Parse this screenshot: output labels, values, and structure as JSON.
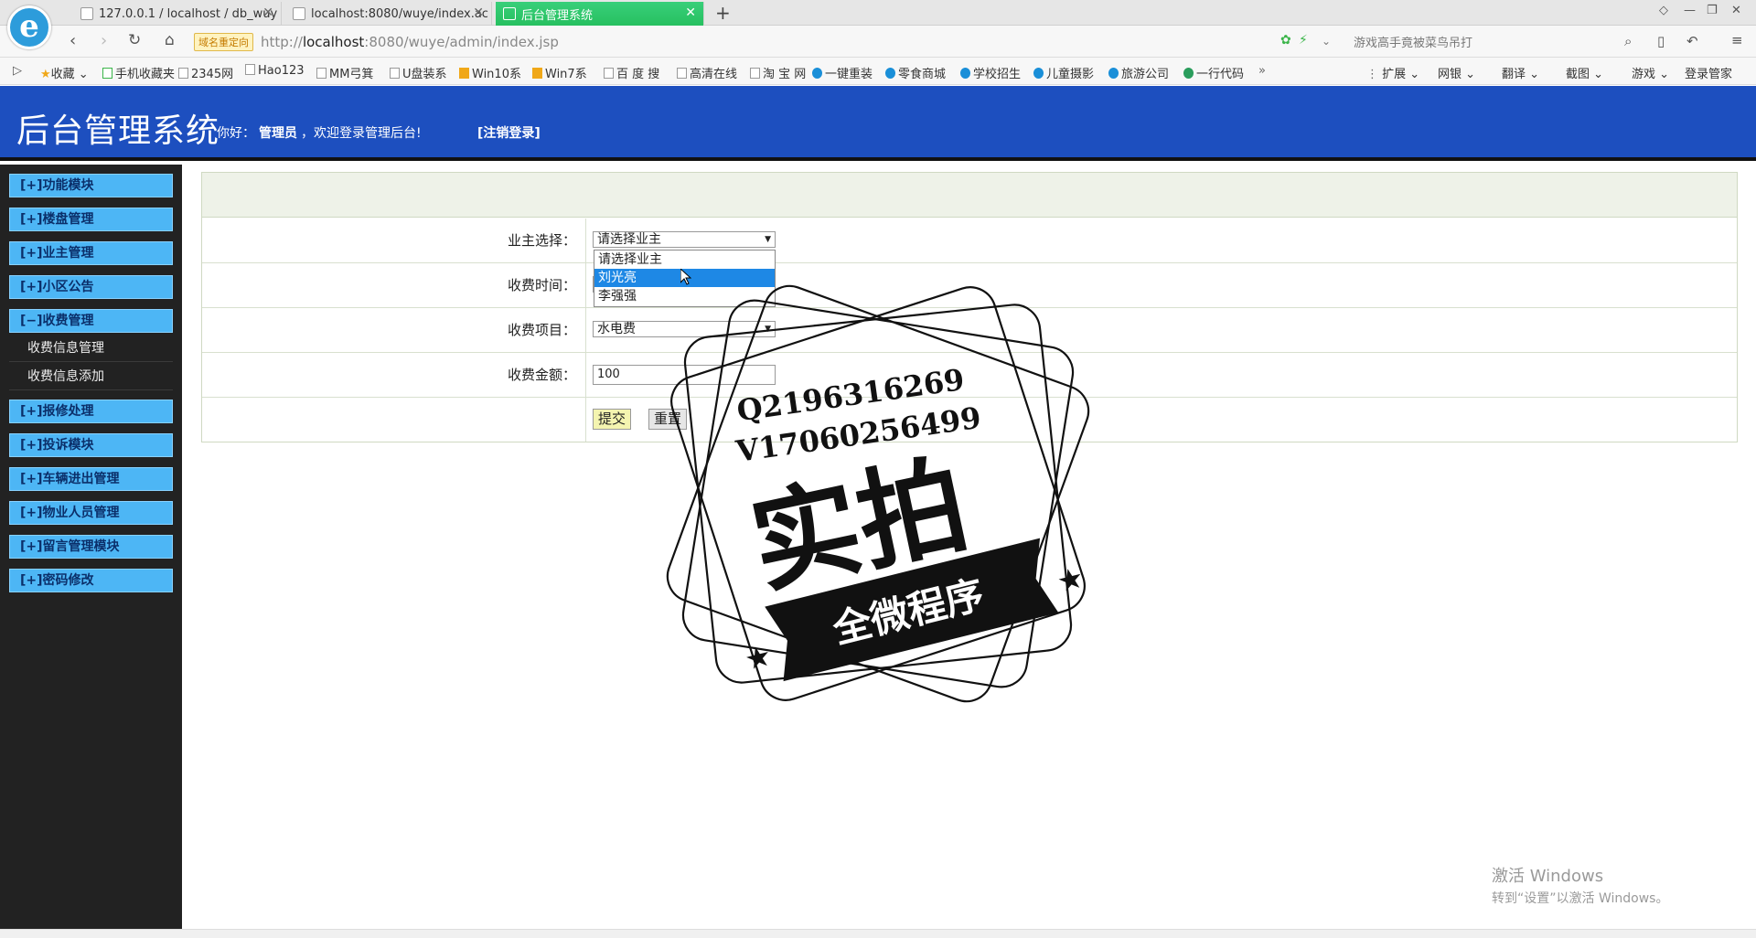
{
  "browser": {
    "tabs": [
      {
        "label": "127.0.0.1 / localhost / db_wuy",
        "icon": "pma-icon"
      },
      {
        "label": "localhost:8080/wuye/index.ac",
        "icon": "page-icon"
      },
      {
        "label": "后台管理系统",
        "icon": "page-icon"
      }
    ],
    "new_tab": "+",
    "redirect_badge": "域名重定向",
    "url_prefix": "http://",
    "url_host": "localhost",
    "url_rest": ":8080/wuye/admin/index.jsp",
    "search_placeholder": "游戏高手竟被菜鸟吊打",
    "bookmarks": [
      "收藏",
      "手机收藏夹",
      "2345网",
      "Hao123",
      "MM弓箕",
      "U盘装系",
      "Win10系",
      "Win7系",
      "百 度 搜",
      "高清在线",
      "淘 宝 网",
      "一键重装",
      "零食商城",
      "学校招生",
      "儿童摄影",
      "旅游公司",
      "一行代码",
      "»"
    ],
    "tools": [
      "扩展",
      "网银",
      "翻译",
      "截图",
      "游戏",
      "登录管家"
    ]
  },
  "header": {
    "title": "后台管理系统",
    "greeting_prefix": "你好：",
    "username": "管理员",
    "greeting_suffix": "，欢迎登录管理后台!",
    "logout": "[注销登录]"
  },
  "sidebar": {
    "items": [
      {
        "label": "[+]功能模块"
      },
      {
        "label": "[+]楼盘管理"
      },
      {
        "label": "[+]业主管理"
      },
      {
        "label": "[+]小区公告"
      },
      {
        "label": "[−]收费管理"
      },
      {
        "label": "[+]报修处理"
      },
      {
        "label": "[+]投诉模块"
      },
      {
        "label": "[+]车辆进出管理"
      },
      {
        "label": "[+]物业人员管理"
      },
      {
        "label": "[+]留言管理模块"
      },
      {
        "label": "[+]密码修改"
      }
    ],
    "subitems": [
      {
        "label": "收费信息管理"
      },
      {
        "label": "收费信息添加"
      }
    ]
  },
  "form": {
    "owner_label": "业主选择：",
    "owner_selected": "请选择业主",
    "owner_options": [
      "请选择业主",
      "刘光亮",
      "李强强"
    ],
    "time_label": "收费时间：",
    "item_label": "收费项目：",
    "item_selected": "水电费",
    "amount_label": "收费金额：",
    "amount_value": "100",
    "submit": "提交",
    "reset": "重置"
  },
  "stamp": {
    "line1": "Q2196316269",
    "line2": "V17060256499",
    "main": "实拍",
    "banner": "全微程序"
  },
  "watermark": {
    "line1": "激活 Windows",
    "line2": "转到“设置”以激活 Windows。"
  }
}
